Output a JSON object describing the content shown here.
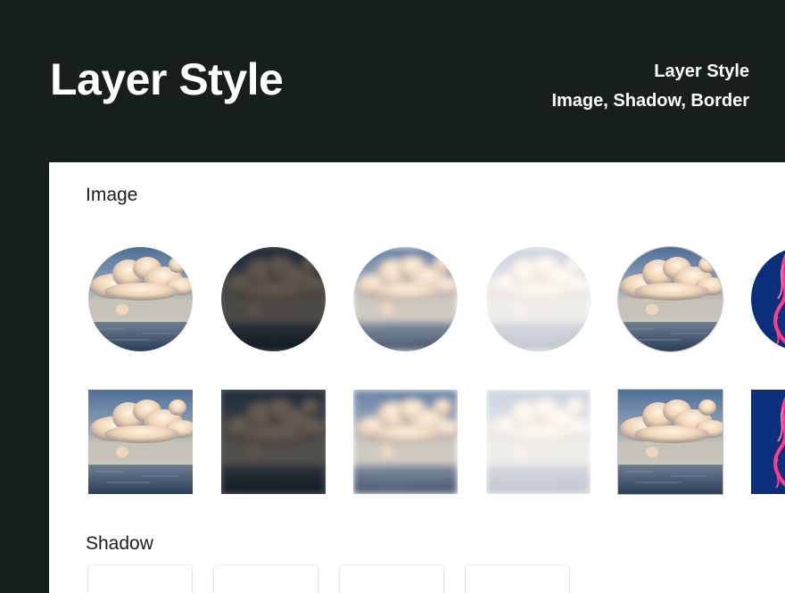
{
  "header": {
    "title": "Layer Style",
    "subtitle_line1": "Layer Style",
    "subtitle_line2": "Image, Shadow, Border"
  },
  "sections": {
    "image": {
      "title": "Image"
    },
    "shadow": {
      "title": "Shadow"
    }
  },
  "colors": {
    "background": "#171e1e",
    "panel": "#ffffff",
    "sky": "#6f8aa8",
    "cloud": "#f2dcc2",
    "sea": "#3f5370",
    "neon_bg": "#0b2f7a",
    "neon_stroke": "#ff3d8a"
  },
  "image_variants": [
    "original",
    "dark-blur",
    "blur",
    "light-blur",
    "original-bordered",
    "neon"
  ],
  "image_shapes": [
    "circle",
    "square"
  ]
}
